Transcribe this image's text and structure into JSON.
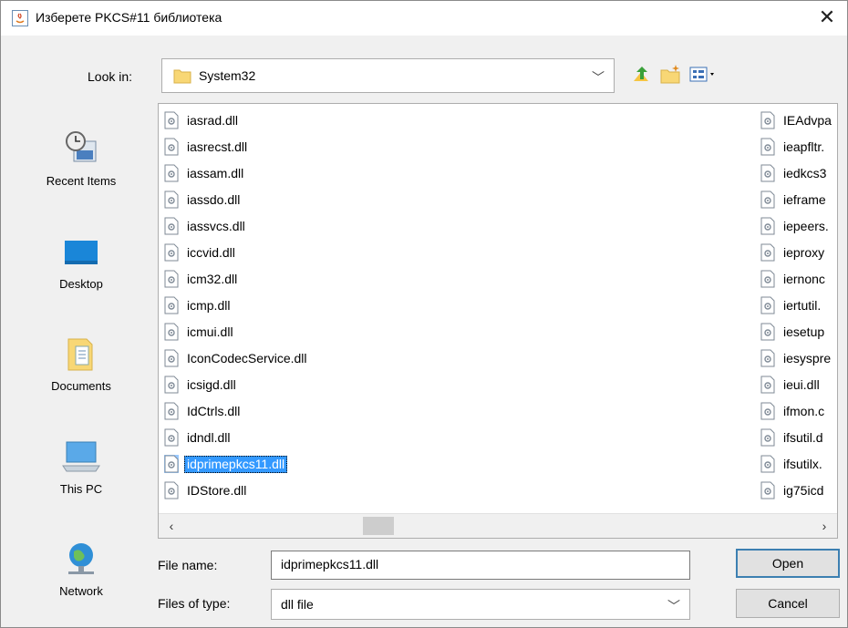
{
  "window": {
    "title": "Изберете PKCS#11 библиотека",
    "close_glyph": "✕"
  },
  "lookin": {
    "label": "Look in:",
    "value": "System32"
  },
  "places": [
    {
      "label": "Recent Items",
      "icon": "recent-items-icon"
    },
    {
      "label": "Desktop",
      "icon": "desktop-icon"
    },
    {
      "label": "Documents",
      "icon": "documents-icon"
    },
    {
      "label": "This PC",
      "icon": "this-pc-icon"
    },
    {
      "label": "Network",
      "icon": "network-icon"
    }
  ],
  "files_col1": [
    "iasrad.dll",
    "iasrecst.dll",
    "iassam.dll",
    "iassdo.dll",
    "iassvcs.dll",
    "iccvid.dll",
    "icm32.dll",
    "icmp.dll",
    "icmui.dll",
    "IconCodecService.dll",
    "icsigd.dll",
    "IdCtrls.dll",
    "idndl.dll",
    "idprimepkcs11.dll",
    "IDStore.dll"
  ],
  "files_col2": [
    "IEAdvpa",
    "ieapfltr.",
    "iedkcs3",
    "ieframe",
    "iepeers.",
    "ieproxy",
    "iernonc",
    "iertutil.",
    "iesetup",
    "iesyspre",
    "ieui.dll",
    "ifmon.c",
    "ifsutil.d",
    "ifsutilx.",
    "ig75icd"
  ],
  "selected_file": "idprimepkcs11.dll",
  "scroll": {
    "left": "‹",
    "right": "›"
  },
  "form": {
    "file_name_label": "File name:",
    "file_name_value": "idprimepkcs11.dll",
    "file_type_label": "Files of type:",
    "file_type_value": "dll file",
    "open_label": "Open",
    "cancel_label": "Cancel"
  },
  "colors": {
    "selection": "#3399ff",
    "default_button_border": "#3c7fb1"
  }
}
